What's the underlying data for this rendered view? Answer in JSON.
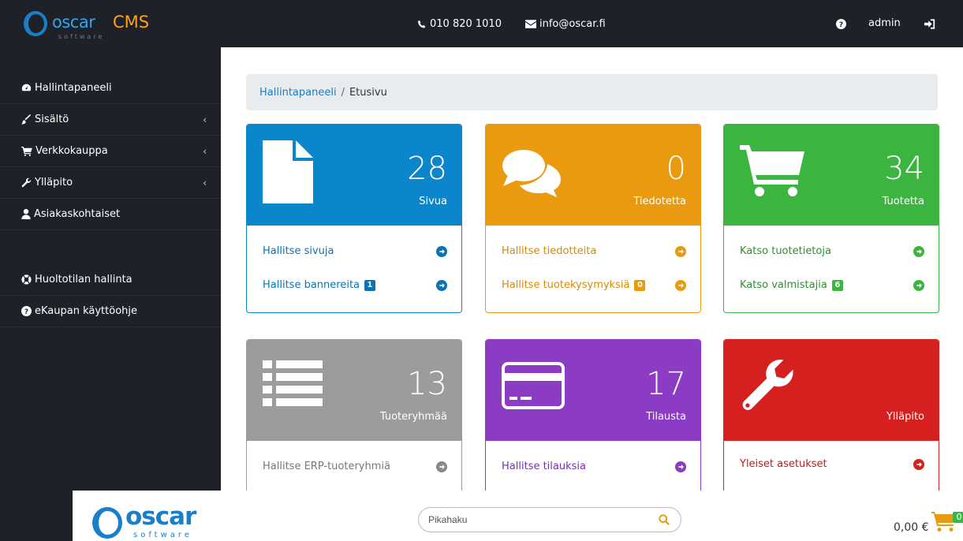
{
  "header": {
    "logo_text": "oscar",
    "logo_cms": "CMS",
    "logo_sub": "software",
    "phone": "010 820 1010",
    "email": "info@oscar.fi",
    "user": "admin"
  },
  "sidebar": {
    "items": [
      {
        "label": "Hallintapaneeli",
        "icon": "dashboard-icon",
        "chevron": ""
      },
      {
        "label": "Sisältö",
        "icon": "brush-icon",
        "chevron": "‹"
      },
      {
        "label": "Verkkokauppa",
        "icon": "cart-icon",
        "chevron": "‹"
      },
      {
        "label": "Ylläpito",
        "icon": "wrench-icon",
        "chevron": "‹"
      },
      {
        "label": "Asiakaskohtaiset",
        "icon": "user-icon",
        "chevron": ""
      },
      {
        "label": "Huoltotilan hallinta",
        "icon": "lifebuoy-icon",
        "chevron": ""
      },
      {
        "label": "eKaupan käyttöohje",
        "icon": "question-icon",
        "chevron": ""
      }
    ]
  },
  "breadcrumb": {
    "link": "Hallintapaneeli",
    "separator": "/",
    "current": "Etusivu"
  },
  "cards": [
    {
      "count": "28",
      "label": "Sivua",
      "color": "#0b86cd",
      "icon": "file-icon",
      "links": [
        {
          "text": "Hallitse sivuja",
          "badge": ""
        },
        {
          "text": "Hallitse bannereita",
          "badge": "1"
        }
      ]
    },
    {
      "count": "0",
      "label": "Tiedotetta",
      "color": "#e99a0e",
      "icon": "comments-icon",
      "links": [
        {
          "text": "Hallitse tiedotteita",
          "badge": ""
        },
        {
          "text": "Hallitse tuotekysymyksiä",
          "badge": "0"
        }
      ]
    },
    {
      "count": "34",
      "label": "Tuotetta",
      "color": "#3cb440",
      "icon": "shopping-cart-icon",
      "links": [
        {
          "text": "Katso tuotetietoja",
          "badge": ""
        },
        {
          "text": "Katso valmistajia",
          "badge": "6"
        }
      ]
    },
    {
      "count": "13",
      "label": "Tuoteryhmää",
      "color": "#9c9c9c",
      "icon": "list-icon",
      "links": [
        {
          "text": "Hallitse ERP-tuoteryhmiä",
          "badge": ""
        }
      ]
    },
    {
      "count": "17",
      "label": "Tilausta",
      "color": "#8b3bc4",
      "icon": "credit-card-icon",
      "links": [
        {
          "text": "Hallitse tilauksia",
          "badge": ""
        }
      ]
    },
    {
      "count": "",
      "label": "Ylläpito",
      "color": "#d62020",
      "icon": "wrench-icon",
      "links": [
        {
          "text": "Yleiset asetukset",
          "badge": ""
        }
      ]
    }
  ],
  "storefront": {
    "logo_text": "oscar",
    "logo_sub": "software",
    "search_placeholder": "Pikahaku",
    "cart_total": "0,00 €",
    "cart_count": "0"
  }
}
